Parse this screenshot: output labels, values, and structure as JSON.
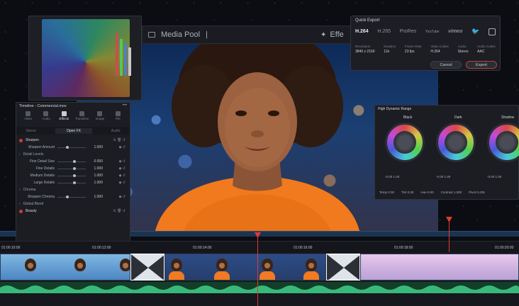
{
  "topbar": {
    "media_pool_label": "Media Pool",
    "media_pool_suffix": "|",
    "effects_label": "Effe"
  },
  "quick_export": {
    "title": "Quick Export",
    "formats": [
      "H.264",
      "H.265",
      "ProRes",
      "YouTube",
      "vimeo",
      "twitter-icon",
      "tiktok-icon"
    ],
    "selected_format": "H.264",
    "meta": [
      {
        "label": "Resolution",
        "value": "3840 x 2160"
      },
      {
        "label": "Duration",
        "value": "12s"
      },
      {
        "label": "Frame Rate",
        "value": "23 fps"
      },
      {
        "label": "Video Codec",
        "value": "H.264"
      },
      {
        "label": "Audio",
        "value": "Stereo"
      },
      {
        "label": "Audio Codec",
        "value": "AAC"
      }
    ],
    "cancel_label": "Cancel",
    "export_label": "Export"
  },
  "inspector": {
    "title": "Timeline - Commercial.mov",
    "tabs": [
      {
        "label": "Video",
        "icon": "video-icon"
      },
      {
        "label": "Audio",
        "icon": "audio-icon"
      },
      {
        "label": "Effects",
        "icon": "effects-icon"
      },
      {
        "label": "Transition",
        "icon": "transition-icon"
      },
      {
        "label": "Image",
        "icon": "image-icon"
      },
      {
        "label": "File",
        "icon": "file-icon"
      }
    ],
    "active_tab": "Effects",
    "subtabs": [
      "Stereo",
      "Open FX",
      "Audio"
    ],
    "rows": [
      {
        "type": "header",
        "label": "Sharpen"
      },
      {
        "type": "param",
        "label": "Sharpen Amount",
        "value": "1.000",
        "pos": 0.3
      },
      {
        "type": "section",
        "label": "Detail Levels"
      },
      {
        "type": "param",
        "label": "Fine Detail Size",
        "value": "0.050",
        "pos": 0.55
      },
      {
        "type": "param",
        "label": "Fine Details",
        "value": "1.000",
        "pos": 0.55
      },
      {
        "type": "param",
        "label": "Medium Details",
        "value": "1.000",
        "pos": 0.55
      },
      {
        "type": "param",
        "label": "Large Details",
        "value": "1.000",
        "pos": 0.55
      },
      {
        "type": "section",
        "label": "Chroma"
      },
      {
        "type": "param",
        "label": "Sharpen Chroma",
        "value": "1.000",
        "pos": 0.3
      },
      {
        "type": "section",
        "label": "Global Blend"
      },
      {
        "type": "header",
        "label": "Beauty"
      }
    ]
  },
  "hdr": {
    "title": "High Dynamic Range",
    "wheels": [
      {
        "label": "Black",
        "exp": "-0.00",
        "sat": "1.00"
      },
      {
        "label": "Dark",
        "exp": "-0.00",
        "sat": "1.00"
      },
      {
        "label": "Shadow",
        "exp": "-0.00",
        "sat": "1.00"
      }
    ],
    "footer": [
      "Temp 0.00",
      "Tint 0.00",
      "Hue 0.00",
      "Contrast 1.000",
      "Pivot 0.435"
    ]
  },
  "timeline": {
    "timecodes": [
      "01:00:10:00",
      "01:00:12:00",
      "01:00:14:00",
      "01:00:16:00",
      "01:00:18:00",
      "01:00:20:00"
    ]
  }
}
